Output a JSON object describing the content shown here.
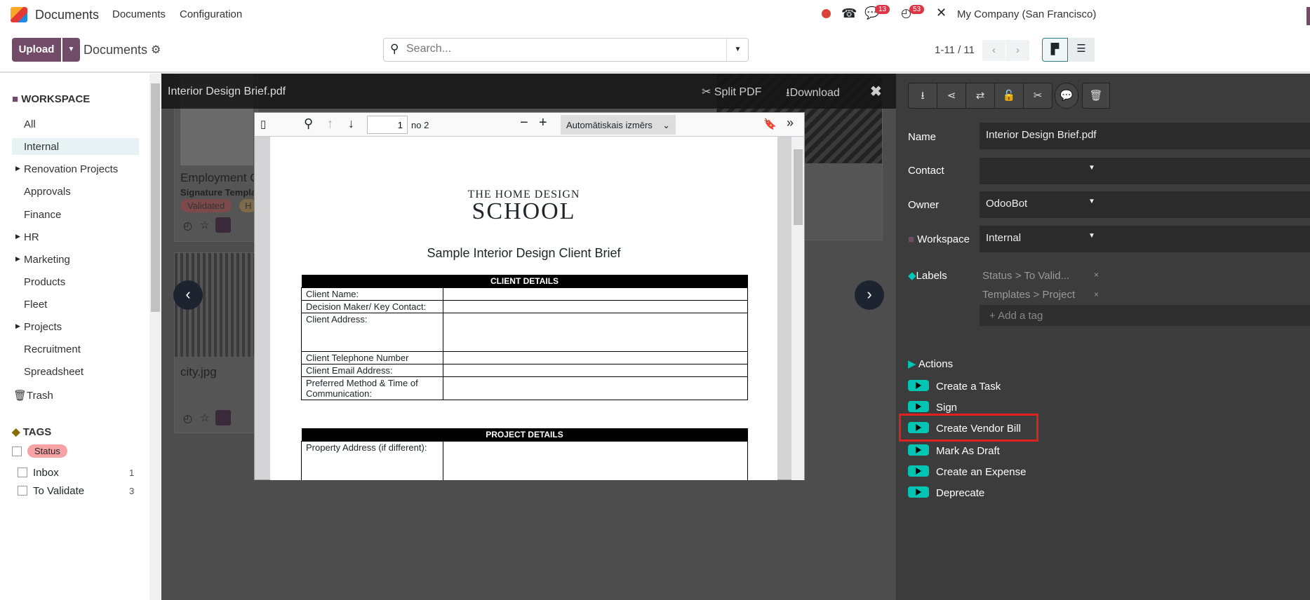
{
  "navbar": {
    "app": "Documents",
    "menus": [
      "Documents",
      "Configuration"
    ],
    "chat_count": "13",
    "activity_count": "53",
    "company": "My Company (San Francisco)"
  },
  "control": {
    "upload": "Upload",
    "breadcrumb": "Documents",
    "search_placeholder": "Search...",
    "pager": "1-11 / 11"
  },
  "sidebar": {
    "workspace_title": "WORKSPACE",
    "items": [
      "All",
      "Internal",
      "Renovation Projects",
      "Approvals",
      "Finance",
      "HR",
      "Marketing",
      "Products",
      "Fleet",
      "Projects",
      "Recruitment",
      "Spreadsheet"
    ],
    "trash": "Trash",
    "tags_title": "TAGS",
    "status_tag": "Status",
    "facets": [
      {
        "label": "Inbox",
        "count": "1"
      },
      {
        "label": "To Validate",
        "count": "3"
      }
    ]
  },
  "cards": [
    {
      "title": "Employment C",
      "subtitle": "Signature Templat",
      "tags": [
        "Validated",
        "H"
      ]
    },
    {
      "title": "city.jpg"
    }
  ],
  "viewer": {
    "title": "Interior Design Brief.pdf",
    "split": "Split PDF",
    "download": "Download",
    "page": "1",
    "page_of": "no 2",
    "zoom": "Automātiskais izmērs"
  },
  "pdf": {
    "logo_top": "THE HOME DESIGN",
    "logo_main": "SCHOOL",
    "heading": "Sample Interior Design Client Brief",
    "client_header": "CLIENT DETAILS",
    "client_rows": [
      "Client Name:",
      "Decision Maker/ Key Contact:",
      "Client Address:",
      "Client Telephone Number",
      "Client Email Address:",
      "Preferred Method & Time of Communication:"
    ],
    "project_header": "PROJECT DETAILS",
    "project_rows": [
      "Property Address (if different):"
    ]
  },
  "panel": {
    "name_label": "Name",
    "name": "Interior Design Brief.pdf",
    "contact_label": "Contact",
    "contact": "",
    "owner_label": "Owner",
    "owner": "OdooBot",
    "workspace_label": "Workspace",
    "workspace": "Internal",
    "labels_label": "Labels",
    "tags": [
      "Status > To Valid...",
      "Templates > Project"
    ],
    "add_tag": "+ Add a tag",
    "actions_title": "Actions",
    "actions": [
      "Create a Task",
      "Sign",
      "Create Vendor Bill",
      "Mark As Draft",
      "Create an Expense",
      "Deprecate"
    ]
  },
  "colors": {
    "brand": "#714b67",
    "action": "#00c4b4",
    "highlight": "#e0201f"
  }
}
